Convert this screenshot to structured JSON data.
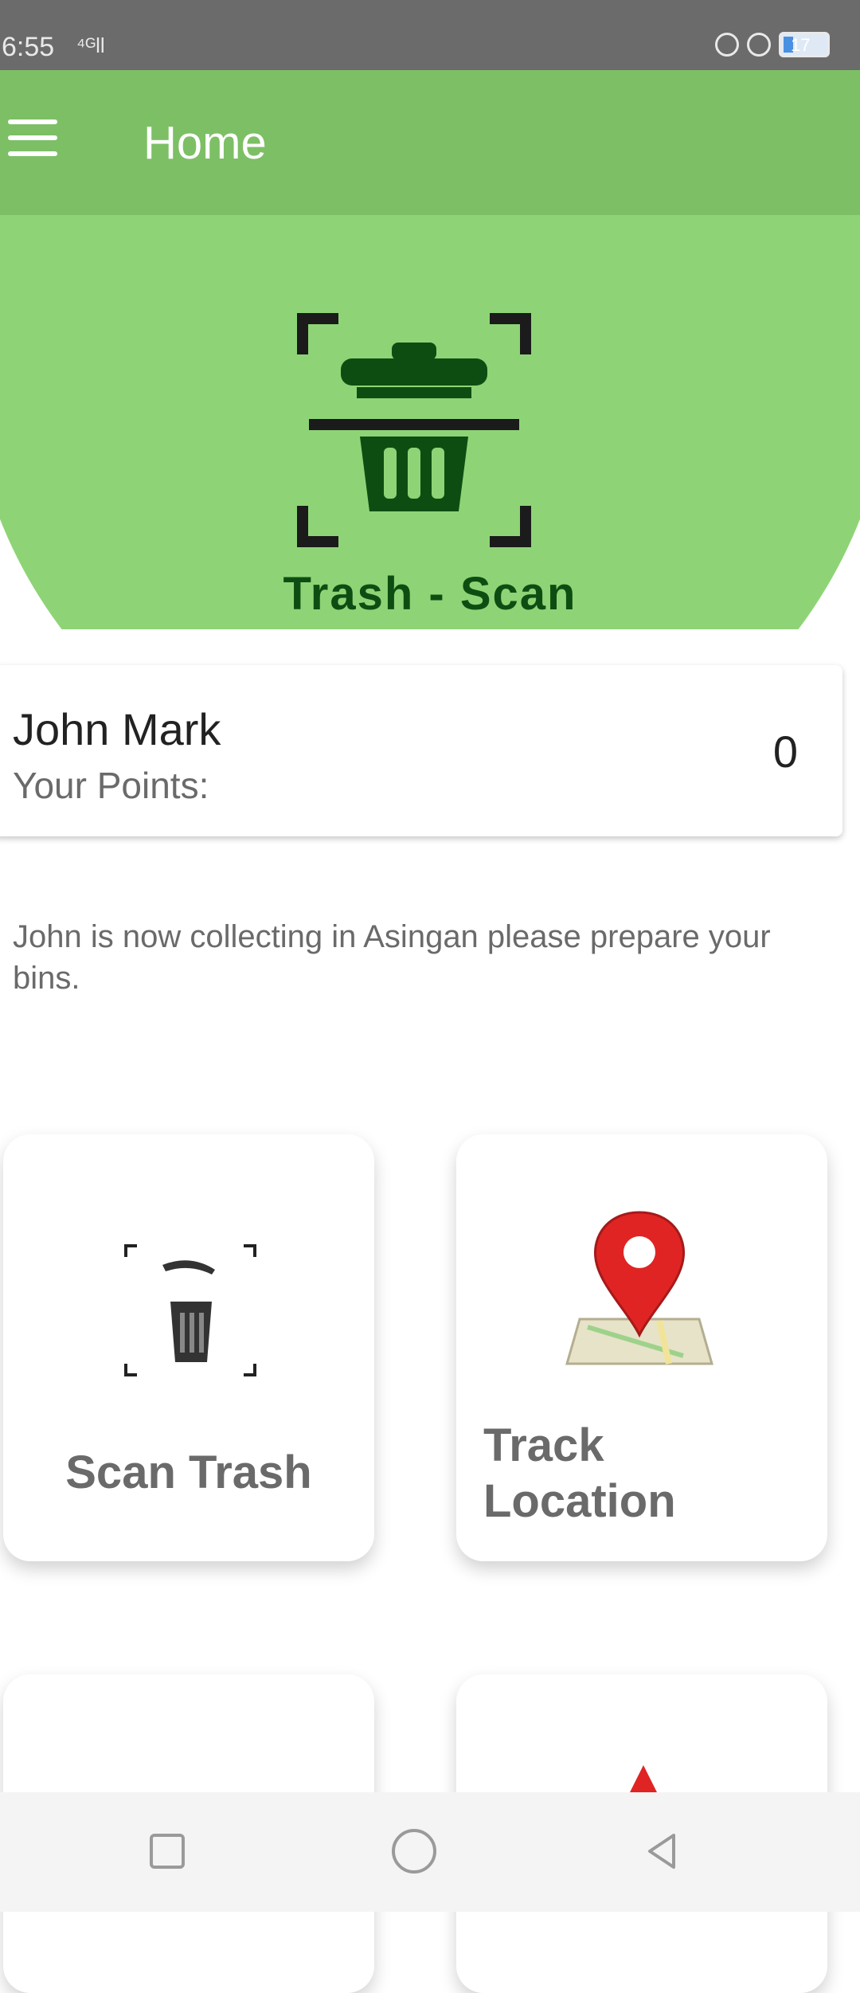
{
  "status_bar": {
    "time": "6:55",
    "signal": "⁴ᴳll",
    "battery": "17"
  },
  "app_bar": {
    "title": "Home"
  },
  "brand": {
    "name": "Trash - Scan"
  },
  "user_card": {
    "name": "John Mark",
    "points_label": "Your Points:",
    "points_value": "0"
  },
  "notice": {
    "text": "John is now collecting in Asingan please prepare your bins."
  },
  "tiles": {
    "scan": {
      "label": "Scan Trash"
    },
    "track": {
      "label": "Track Location"
    }
  },
  "colors": {
    "app_bar": "#7dbf65",
    "hero": "#8ed476",
    "brand_text": "#0e4d12",
    "pin_red": "#e02424"
  },
  "icons": [
    "menu-icon",
    "trash-scan-logo",
    "scan-trash-icon",
    "location-pin-icon",
    "recent-apps-icon",
    "home-icon",
    "back-icon"
  ]
}
